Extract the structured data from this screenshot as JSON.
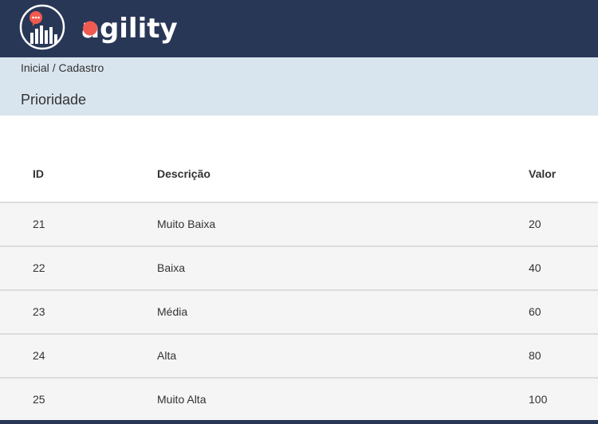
{
  "brand": {
    "name": "agility",
    "color_primary": "#293757",
    "color_accent": "#f05a50"
  },
  "breadcrumb": {
    "home": "Inicial",
    "separator": "/",
    "current": "Cadastro"
  },
  "page": {
    "title": "Prioridade"
  },
  "table": {
    "headers": {
      "id": "ID",
      "descricao": "Descrição",
      "valor": "Valor"
    },
    "rows": [
      {
        "id": "21",
        "descricao": "Muito Baixa",
        "valor": "20"
      },
      {
        "id": "22",
        "descricao": "Baixa",
        "valor": "40"
      },
      {
        "id": "23",
        "descricao": "Média",
        "valor": "60"
      },
      {
        "id": "24",
        "descricao": "Alta",
        "valor": "80"
      },
      {
        "id": "25",
        "descricao": "Muito Alta",
        "valor": "100"
      }
    ]
  }
}
